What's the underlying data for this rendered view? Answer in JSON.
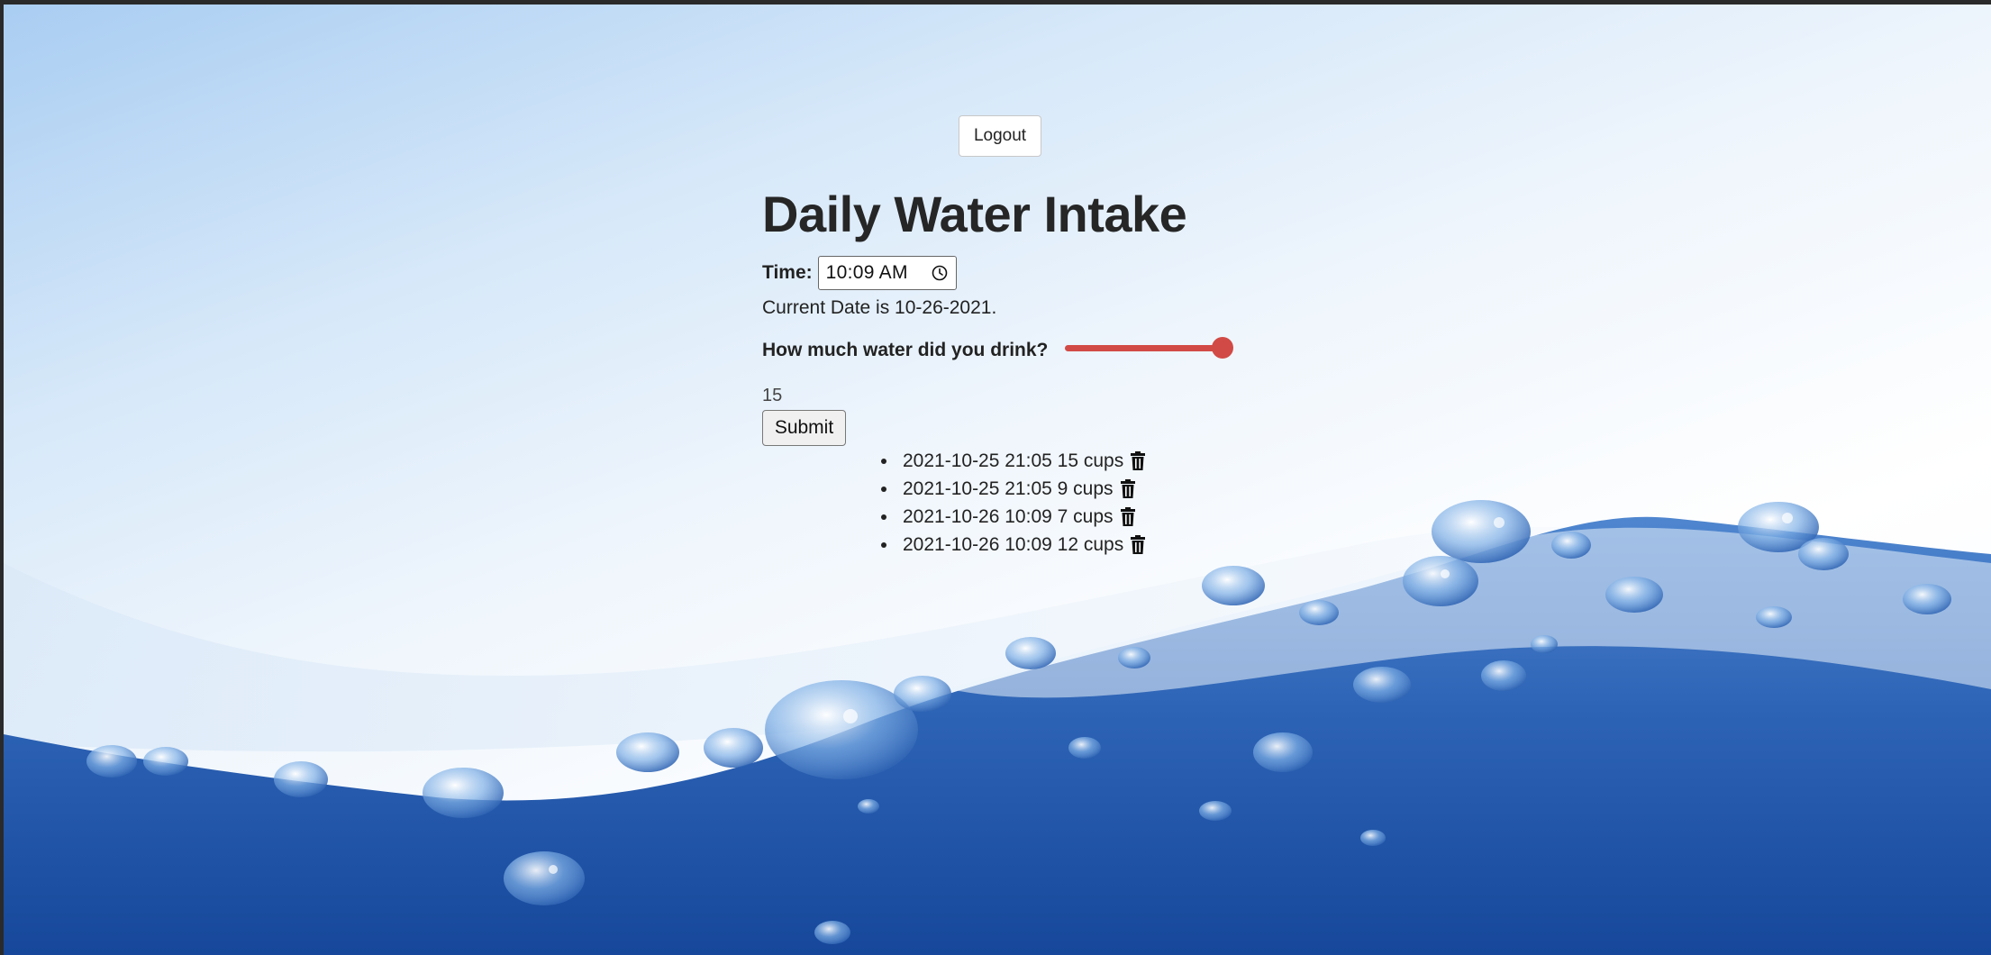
{
  "header": {
    "logout_label": "Logout"
  },
  "page": {
    "title": "Daily Water Intake"
  },
  "form": {
    "time_label": "Time:",
    "time_value": "10:09 AM",
    "date_text": "Current Date is 10-26-2021.",
    "question": "How much water did you drink?",
    "slider_value": "15",
    "slider_fraction": 0.95,
    "submit_label": "Submit"
  },
  "entries": [
    {
      "text": "2021-10-25 21:05 15 cups"
    },
    {
      "text": "2021-10-25 21:05 9 cups"
    },
    {
      "text": "2021-10-26 10:09 7 cups"
    },
    {
      "text": "2021-10-26 10:09 12 cups"
    }
  ],
  "colors": {
    "slider": "#d24a45",
    "water_deep": "#1f4fa0",
    "water_light": "#4f86cf"
  },
  "icons": {
    "clock": "clock-icon",
    "trash": "trash-icon"
  }
}
